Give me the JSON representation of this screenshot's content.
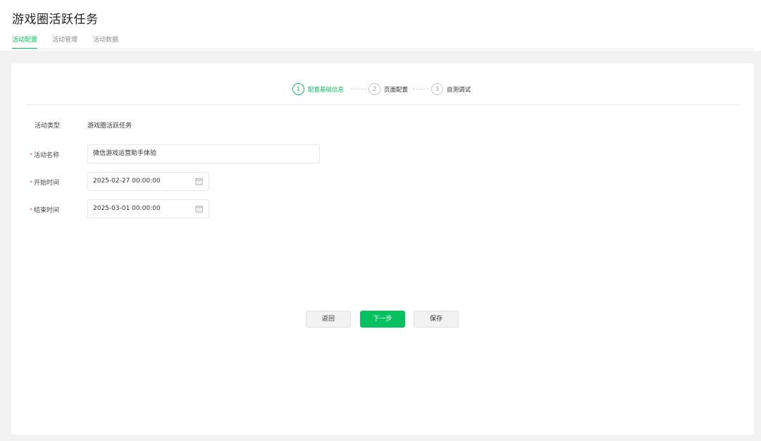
{
  "page": {
    "title": "游戏圈活跃任务"
  },
  "tabs": [
    {
      "label": "活动配置",
      "active": true
    },
    {
      "label": "活动管理",
      "active": false
    },
    {
      "label": "活动数据",
      "active": false
    }
  ],
  "steps": [
    {
      "num": "1",
      "label": "配置基础信息",
      "active": true
    },
    {
      "num": "2",
      "label": "页面配置",
      "active": false
    },
    {
      "num": "3",
      "label": "自测调试",
      "active": false
    }
  ],
  "form": {
    "activity_type": {
      "label": "活动类型",
      "value": "游戏圈活跃任务"
    },
    "activity_name": {
      "label": "活动名称",
      "required_mark": "*",
      "value": "微信游戏运营助手体验"
    },
    "start_time": {
      "label": "开始时间",
      "required_mark": "*",
      "value": "2025-02-27 00:00:00",
      "icon": "calendar-icon"
    },
    "end_time": {
      "label": "结束时间",
      "required_mark": "*",
      "value": "2025-03-01 00:00:00",
      "icon": "calendar-icon"
    }
  },
  "buttons": {
    "back": "返回",
    "next": "下一步",
    "save": "保存"
  },
  "colors": {
    "accent": "#07c160",
    "required": "#fa5151",
    "background": "#f2f2f2"
  }
}
